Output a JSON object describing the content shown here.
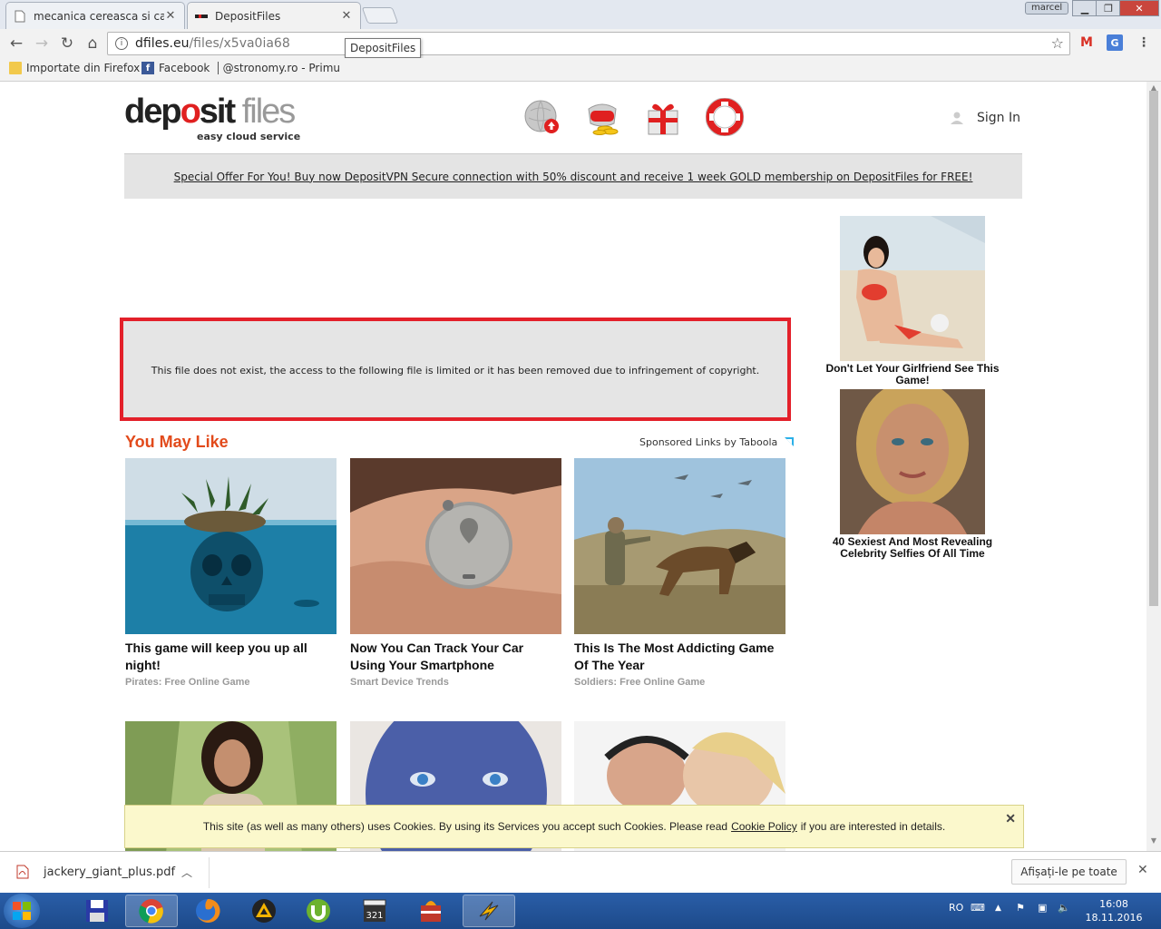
{
  "browser": {
    "tabs": [
      {
        "title": "mecanica cereasca si calc",
        "active": false
      },
      {
        "title": "DepositFiles",
        "active": true
      }
    ],
    "profile_name": "marcel",
    "url_host": "dfiles.eu",
    "url_path": "/files/x5va0ia68",
    "tooltip": "DepositFiles",
    "bookmarks": [
      {
        "label": "Importate din Firefox",
        "icon": "folder-icon"
      },
      {
        "label": "Facebook",
        "icon": "facebook-icon"
      },
      {
        "label": "@stronomy.ro - Primu",
        "icon": "site-icon"
      }
    ]
  },
  "site": {
    "logo": {
      "part1": "dep",
      "part2": "o",
      "part3": "sit",
      "part4": " files",
      "tagline": "easy cloud service"
    },
    "header_icons": [
      "upload-globe-icon",
      "wallet-coins-icon",
      "gift-icon",
      "lifebuoy-icon"
    ],
    "signin_label": "Sign In",
    "offer_text": "Special Offer For You! Buy now DepositVPN Secure connection with 50% discount and receive 1 week GOLD membership on DepositFiles for FREE!",
    "error_message": "This file does not exist, the access to the following file is limited or it has been removed due to infringement of copyright.",
    "you_may_like": "You May Like",
    "sponsored": "Sponsored Links by Taboola",
    "cards": [
      {
        "title": "This game will keep you up all night!",
        "source": "Pirates: Free Online Game"
      },
      {
        "title": "Now You Can Track Your Car Using Your Smartphone",
        "source": "Smart Device Trends"
      },
      {
        "title": "This Is The Most Addicting Game Of The Year",
        "source": "Soldiers: Free Online Game"
      }
    ],
    "side_ads": [
      {
        "title": "Don't Let Your Girlfriend See This Game!"
      },
      {
        "title": "40 Sexiest And Most Revealing Celebrity Selfies Of All Time"
      }
    ],
    "cookie": {
      "text_before": "This site (as well as many others) uses Cookies. By using its Services you accept such Cookies. Please read",
      "link": "Cookie Policy",
      "text_after": "if you are interested in details.",
      "close": "✕"
    }
  },
  "downloads": {
    "file": "jackery_giant_plus.pdf",
    "show_all": "Afișați-le pe toate"
  },
  "taskbar": {
    "lang": "RO",
    "time": "16:08",
    "date": "18.11.2016"
  },
  "colors": {
    "error_border": "#e3202a",
    "you_may_like": "#e24a1b",
    "logo_red": "#e02020"
  }
}
